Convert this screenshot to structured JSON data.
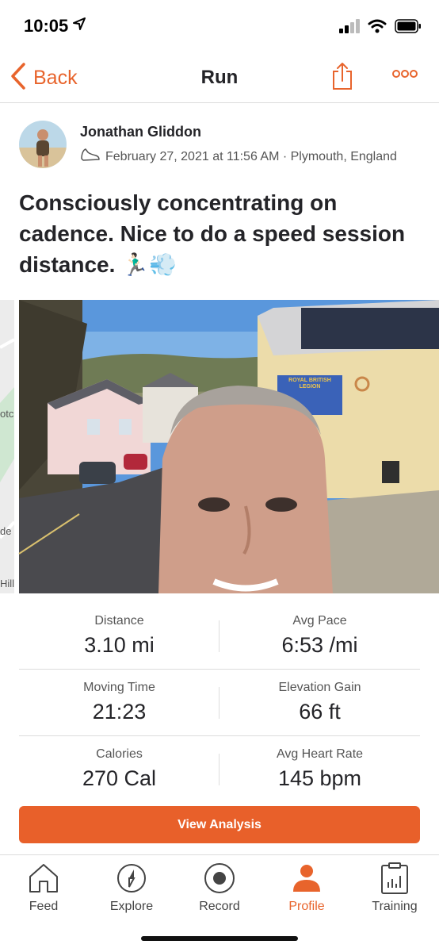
{
  "status": {
    "time": "10:05"
  },
  "nav": {
    "back_label": "Back",
    "title": "Run"
  },
  "activity": {
    "athlete_name": "Jonathan Gliddon",
    "meta": "February 27, 2021 at 11:56 AM · Plymouth, England",
    "title": "Consciously concentrating on cadence. Nice to do a speed session distance. 🏃🏻‍♂️💨"
  },
  "photo": {
    "sign_text": "ROYAL BRITISH LEGION"
  },
  "map": {
    "labels": [
      "otc",
      "de",
      "Hill"
    ]
  },
  "stats": {
    "distance_label": "Distance",
    "distance_value": "3.10 mi",
    "pace_label": "Avg Pace",
    "pace_value": "6:53 /mi",
    "moving_label": "Moving Time",
    "moving_value": "21:23",
    "elevation_label": "Elevation Gain",
    "elevation_value": "66 ft",
    "calories_label": "Calories",
    "calories_value": "270 Cal",
    "hr_label": "Avg Heart Rate",
    "hr_value": "145 bpm"
  },
  "analysis_button": "View Analysis",
  "tabs": [
    {
      "label": "Feed",
      "icon": "home-icon"
    },
    {
      "label": "Explore",
      "icon": "compass-icon"
    },
    {
      "label": "Record",
      "icon": "record-icon"
    },
    {
      "label": "Profile",
      "icon": "profile-icon"
    },
    {
      "label": "Training",
      "icon": "training-icon"
    }
  ],
  "colors": {
    "accent": "#e8642c",
    "button": "#e8602a",
    "text": "#242428"
  }
}
